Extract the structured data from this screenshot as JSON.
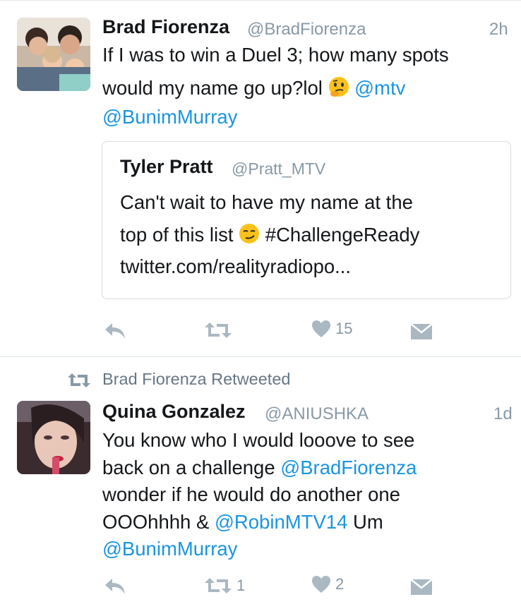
{
  "tweets": [
    {
      "author": "Brad Fiorenza",
      "handle": "@BradFiorenza",
      "time": "2h",
      "line1": "If I was to win a Duel 3; how many spots",
      "line2_pre": "would my name go up?lol",
      "line2_emoji": "thinking-face",
      "line2_link": "@mtv",
      "line3_link": "@BunimMurray",
      "quote": {
        "author": "Tyler Pratt",
        "handle": "@Pratt_MTV",
        "line1": "Can't wait to have my name at the",
        "line2_pre": "top of this list",
        "line2_emoji": "smirking-face",
        "line2_post": "#ChallengeReady",
        "line3": "twitter.com/realityradiopo..."
      },
      "actions": {
        "reply": "",
        "retweet": "",
        "like": "15",
        "dm": ""
      }
    },
    {
      "retweet_context": "Brad Fiorenza Retweeted",
      "author": "Quina Gonzalez",
      "handle": "@ANIUSHKA",
      "time": "1d",
      "line1": "You know who I would looove to see",
      "line2_pre": "back on a challenge",
      "line2_link": "@BradFiorenza",
      "line3": "wonder if he would do another one",
      "line4_pre": "OOOhhhh &",
      "line4_link": "@RobinMTV14",
      "line4_post": "Um",
      "line5_link": "@BunimMurray",
      "actions": {
        "reply": "",
        "retweet": "1",
        "like": "2",
        "dm": ""
      }
    }
  ],
  "colors": {
    "link": "#1b95e0",
    "muted": "#8899a6",
    "icon": "#aab8c2"
  }
}
